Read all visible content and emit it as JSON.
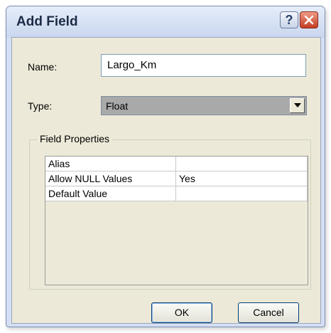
{
  "dialog": {
    "title": "Add Field",
    "help_glyph": "?",
    "name_label": "Name:",
    "name_value": "Largo_Km",
    "type_label": "Type:",
    "type_value": "Float",
    "field_properties": {
      "legend": "Field Properties",
      "rows": [
        {
          "property": "Alias",
          "value": ""
        },
        {
          "property": "Allow NULL Values",
          "value": "Yes"
        },
        {
          "property": "Default Value",
          "value": ""
        }
      ]
    },
    "ok_label": "OK",
    "cancel_label": "Cancel"
  },
  "colors": {
    "titlebar": "#d5dff3",
    "client_area": "#ece9d8",
    "close_button": "#c43d22"
  },
  "icons": {
    "help": "help-icon",
    "close": "close-icon",
    "dropdown": "chevron-down-icon"
  }
}
